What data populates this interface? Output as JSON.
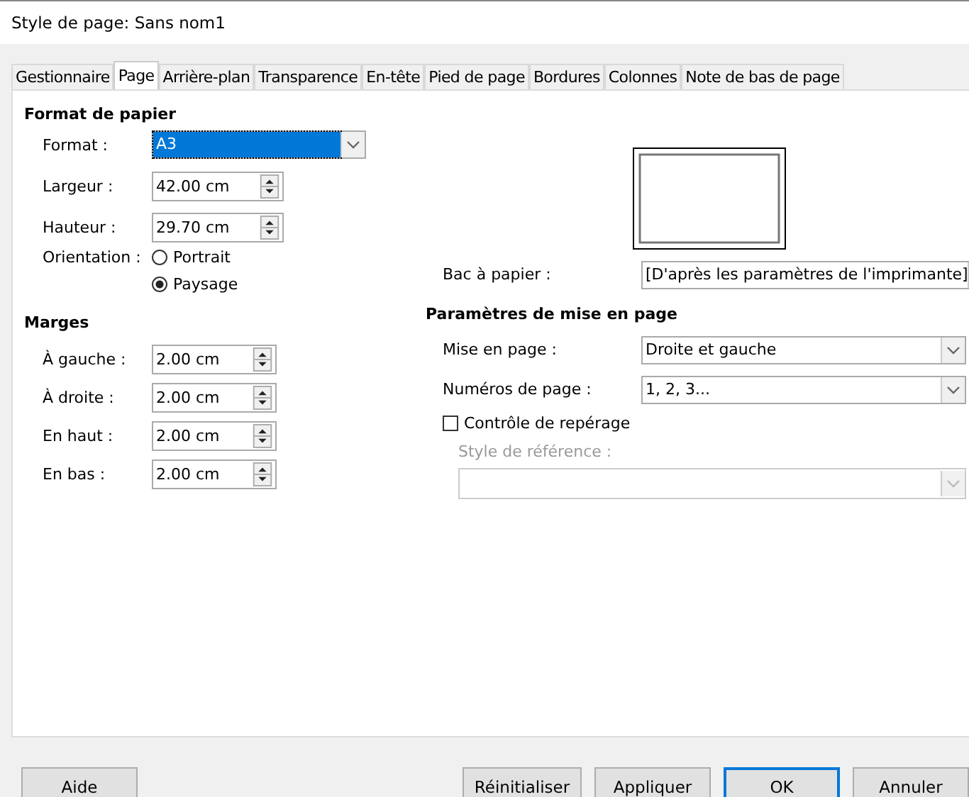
{
  "window": {
    "title": "Style de page: Sans nom1"
  },
  "tabs": [
    {
      "label": "Gestionnaire",
      "selected": false
    },
    {
      "label": "Page",
      "selected": true
    },
    {
      "label": "Arrière-plan",
      "selected": false
    },
    {
      "label": "Transparence",
      "selected": false
    },
    {
      "label": "En-tête",
      "selected": false
    },
    {
      "label": "Pied de page",
      "selected": false
    },
    {
      "label": "Bordures",
      "selected": false
    },
    {
      "label": "Colonnes",
      "selected": false
    },
    {
      "label": "Note de bas de page",
      "selected": false
    }
  ],
  "paper_format": {
    "heading": "Format de papier",
    "format": {
      "label": "Format :",
      "value": "A3",
      "focused": true
    },
    "sizes": [
      {
        "label": "Largeur :",
        "value": "42.00 cm"
      },
      {
        "label": "Hauteur :",
        "value": "29.70 cm"
      }
    ],
    "orientation": {
      "label": "Orientation :",
      "options": [
        {
          "label": "Portrait",
          "selected": false
        },
        {
          "label": "Paysage",
          "selected": true
        }
      ]
    }
  },
  "paper_tray": {
    "label": "Bac à papier :",
    "value": "[D'après les paramètres de l'imprimante]"
  },
  "margins": {
    "heading": "Marges",
    "fields": [
      {
        "label": "À gauche :",
        "value": "2.00 cm"
      },
      {
        "label": "À droite :",
        "value": "2.00 cm"
      },
      {
        "label": "En haut :",
        "value": "2.00 cm"
      },
      {
        "label": "En bas :",
        "value": "2.00 cm"
      }
    ]
  },
  "layout_settings": {
    "heading": "Paramètres de mise en page",
    "selects": [
      {
        "label": "Mise en page :",
        "value": "Droite et gauche"
      },
      {
        "label": "Numéros de page :",
        "value": "1, 2, 3..."
      }
    ],
    "register_true": {
      "label": "Contrôle de repérage",
      "checked": false
    },
    "reference_style": {
      "label": "Style de référence :",
      "disabled": true
    }
  },
  "buttons": [
    {
      "label": "Aide",
      "default": false
    },
    {
      "label": "Réinitialiser",
      "default": false
    },
    {
      "label": "Appliquer",
      "default": false
    },
    {
      "label": "OK",
      "default": true
    },
    {
      "label": "Annuler",
      "default": false
    }
  ]
}
